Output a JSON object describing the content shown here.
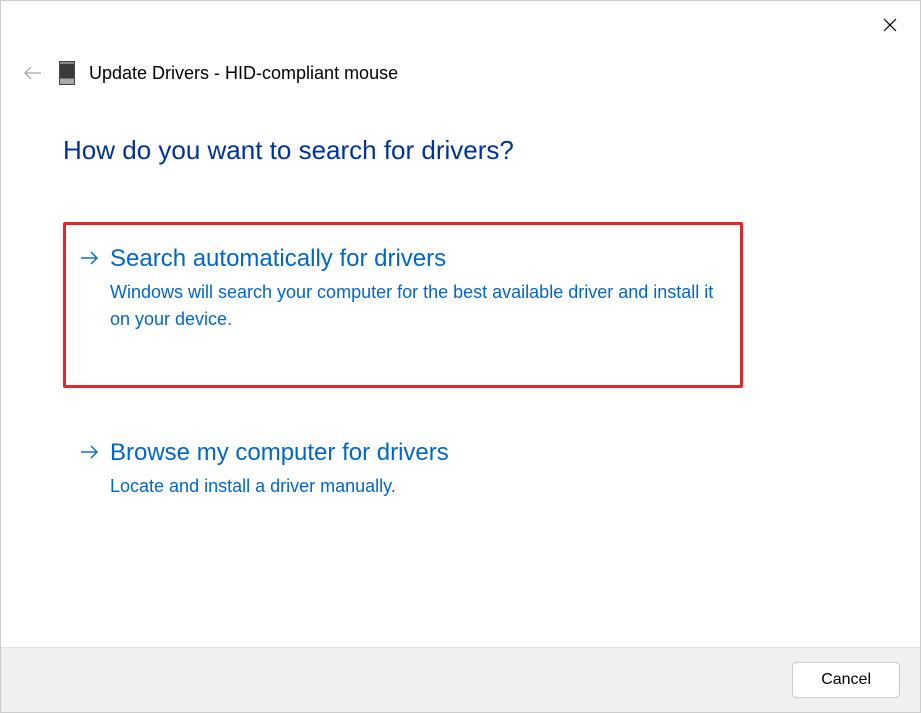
{
  "window": {
    "title": "Update Drivers - HID-compliant mouse"
  },
  "heading": "How do you want to search for drivers?",
  "options": [
    {
      "title": "Search automatically for drivers",
      "description": "Windows will search your computer for the best available driver and install it on your device.",
      "highlighted": true
    },
    {
      "title": "Browse my computer for drivers",
      "description": "Locate and install a driver manually.",
      "highlighted": false
    }
  ],
  "buttons": {
    "cancel": "Cancel"
  },
  "colors": {
    "link_blue": "#0066cc",
    "heading_blue": "#003399",
    "highlight_red": "#e12828"
  }
}
